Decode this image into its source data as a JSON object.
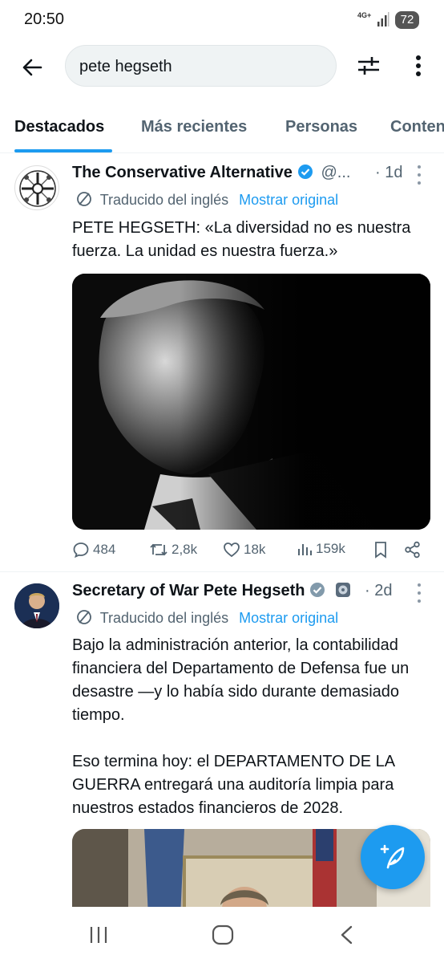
{
  "status": {
    "time": "20:50",
    "network": "4G+",
    "battery": "72"
  },
  "search": {
    "query": "pete hegseth"
  },
  "tabs": [
    {
      "label": "Destacados",
      "active": true
    },
    {
      "label": "Más recientes"
    },
    {
      "label": "Personas"
    },
    {
      "label": "Contenido multimedia"
    }
  ],
  "tweets": [
    {
      "name": "The Conservative Alternative",
      "handle": "@...",
      "age": "· 1d",
      "translated": "Traducido del inglés",
      "show_original": "Mostrar original",
      "text": "PETE HEGSETH: «La diversidad no es nuestra fuerza. La unidad es nuestra fuerza.»",
      "stats": {
        "replies": "484",
        "retweets": "2,8k",
        "likes": "18k",
        "views": "159k"
      }
    },
    {
      "name": "Secretary of War Pete Hegseth",
      "age": "· 2d",
      "translated": "Traducido del inglés",
      "show_original": "Mostrar original",
      "text": "Bajo la administración anterior, la contabilidad financiera del Departamento de Defensa fue un desastre —y lo había sido durante demasiado tiempo.\n\nEso termina hoy: el DEPARTAMENTO DE LA GUERRA entregará una auditoría limpia para nuestros estados financieros de 2028."
    }
  ],
  "colors": {
    "accent": "#1d9bf0",
    "text": "#0f1419",
    "muted": "#536471"
  }
}
